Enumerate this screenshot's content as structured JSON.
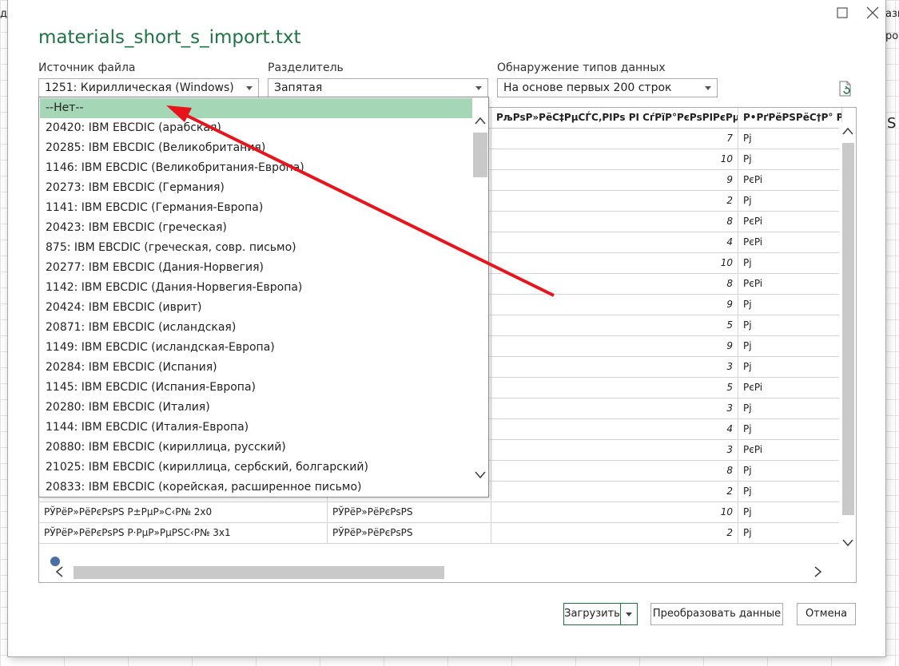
{
  "background": {
    "left_text": "ди",
    "right_text_1": "азг",
    "right_text_2": "ро",
    "right_text_3": "S"
  },
  "dialog": {
    "title": "materials_short_s_import.txt",
    "accent_color": "#217346",
    "window_buttons": [
      "maximize-icon",
      "close-icon"
    ]
  },
  "file_origin": {
    "label": "Источник файла",
    "value": "1251: Кириллическая (Windows)"
  },
  "delimiter": {
    "label": "Разделитель",
    "value": "Запятая"
  },
  "type_detection": {
    "label": "Обнаружение типов данных",
    "value": "На основе первых 200 строк"
  },
  "dropdown": {
    "selected_color": "#a5d6b5",
    "items": [
      "--Нет--",
      "20420: IBM EBCDIC (арабская)",
      "20285: IBM EBCDIC (Великобритания)",
      "1146: IBM EBCDIC (Великобритания-Европа)",
      "20273: IBM EBCDIC (Германия)",
      "1141: IBM EBCDIC (Германия-Европа)",
      "20423: IBM EBCDIC (греческая)",
      "875: IBM EBCDIC (греческая, совр. письмо)",
      "20277: IBM EBCDIC (Дания-Норвегия)",
      "1142: IBM EBCDIC (Дания-Норвегия-Европа)",
      "20424: IBM EBCDIC (иврит)",
      "20871: IBM EBCDIC (исландская)",
      "1149: IBM EBCDIC (исландская-Европа)",
      "20284: IBM EBCDIC (Испания)",
      "1145: IBM EBCDIC (Испания-Европа)",
      "20280: IBM EBCDIC (Италия)",
      "1144: IBM EBCDIC (Италия-Европа)",
      "20880: IBM EBCDIC (кириллица, русский)",
      "21025: IBM EBCDIC (кириллица, сербский, болгарский)",
      "20833: IBM EBCDIC (корейская, расширенное письмо)"
    ]
  },
  "preview": {
    "headers": [
      "",
      "",
      "РљРѕР»РёС‡РµСЃС‚РІРѕ РІ СѓРїР°РєРѕРІРєРµ",
      "Р•РґРёРЅРёС†Р° РёР"
    ],
    "rows": [
      [
        "",
        "",
        "7",
        "Pj"
      ],
      [
        "",
        "",
        "10",
        "Pj"
      ],
      [
        "",
        "",
        "9",
        "PєPi"
      ],
      [
        "",
        "",
        "2",
        "Pj"
      ],
      [
        "",
        "",
        "8",
        "PєPi"
      ],
      [
        "",
        "",
        "4",
        "PєPi"
      ],
      [
        "",
        "",
        "10",
        "Pj"
      ],
      [
        "",
        "",
        "8",
        "PєPi"
      ],
      [
        "",
        "",
        "9",
        "Pj"
      ],
      [
        "",
        "",
        "5",
        "Pj"
      ],
      [
        "",
        "",
        "9",
        "Pj"
      ],
      [
        "",
        "",
        "3",
        "Pj"
      ],
      [
        "",
        "",
        "5",
        "PєPi"
      ],
      [
        "",
        "",
        "3",
        "Pj"
      ],
      [
        "",
        "",
        "4",
        "Pj"
      ],
      [
        "",
        "",
        "3",
        "PєPi"
      ],
      [
        "",
        "",
        "8",
        "Pj"
      ],
      [
        "",
        "",
        "2",
        "Pj"
      ],
      [
        "РЎРёР»РёРєРѕРЅ Р±РµР»С‹Р№ 2х0",
        "РЎРёР»РёРєРѕРЅ",
        "10",
        "Pj"
      ],
      [
        "РЎРёР»РёРєРѕРЅ Р·РµР»РµРЅС‹Р№ 3х1",
        "РЎРёР»РёРєРѕРЅ",
        "2",
        "Pj"
      ]
    ]
  },
  "buttons": {
    "load": "Загрузить",
    "transform": "Преобразовать данные",
    "cancel": "Отмена"
  },
  "annotation": {
    "arrow_color": "#e8141c"
  }
}
